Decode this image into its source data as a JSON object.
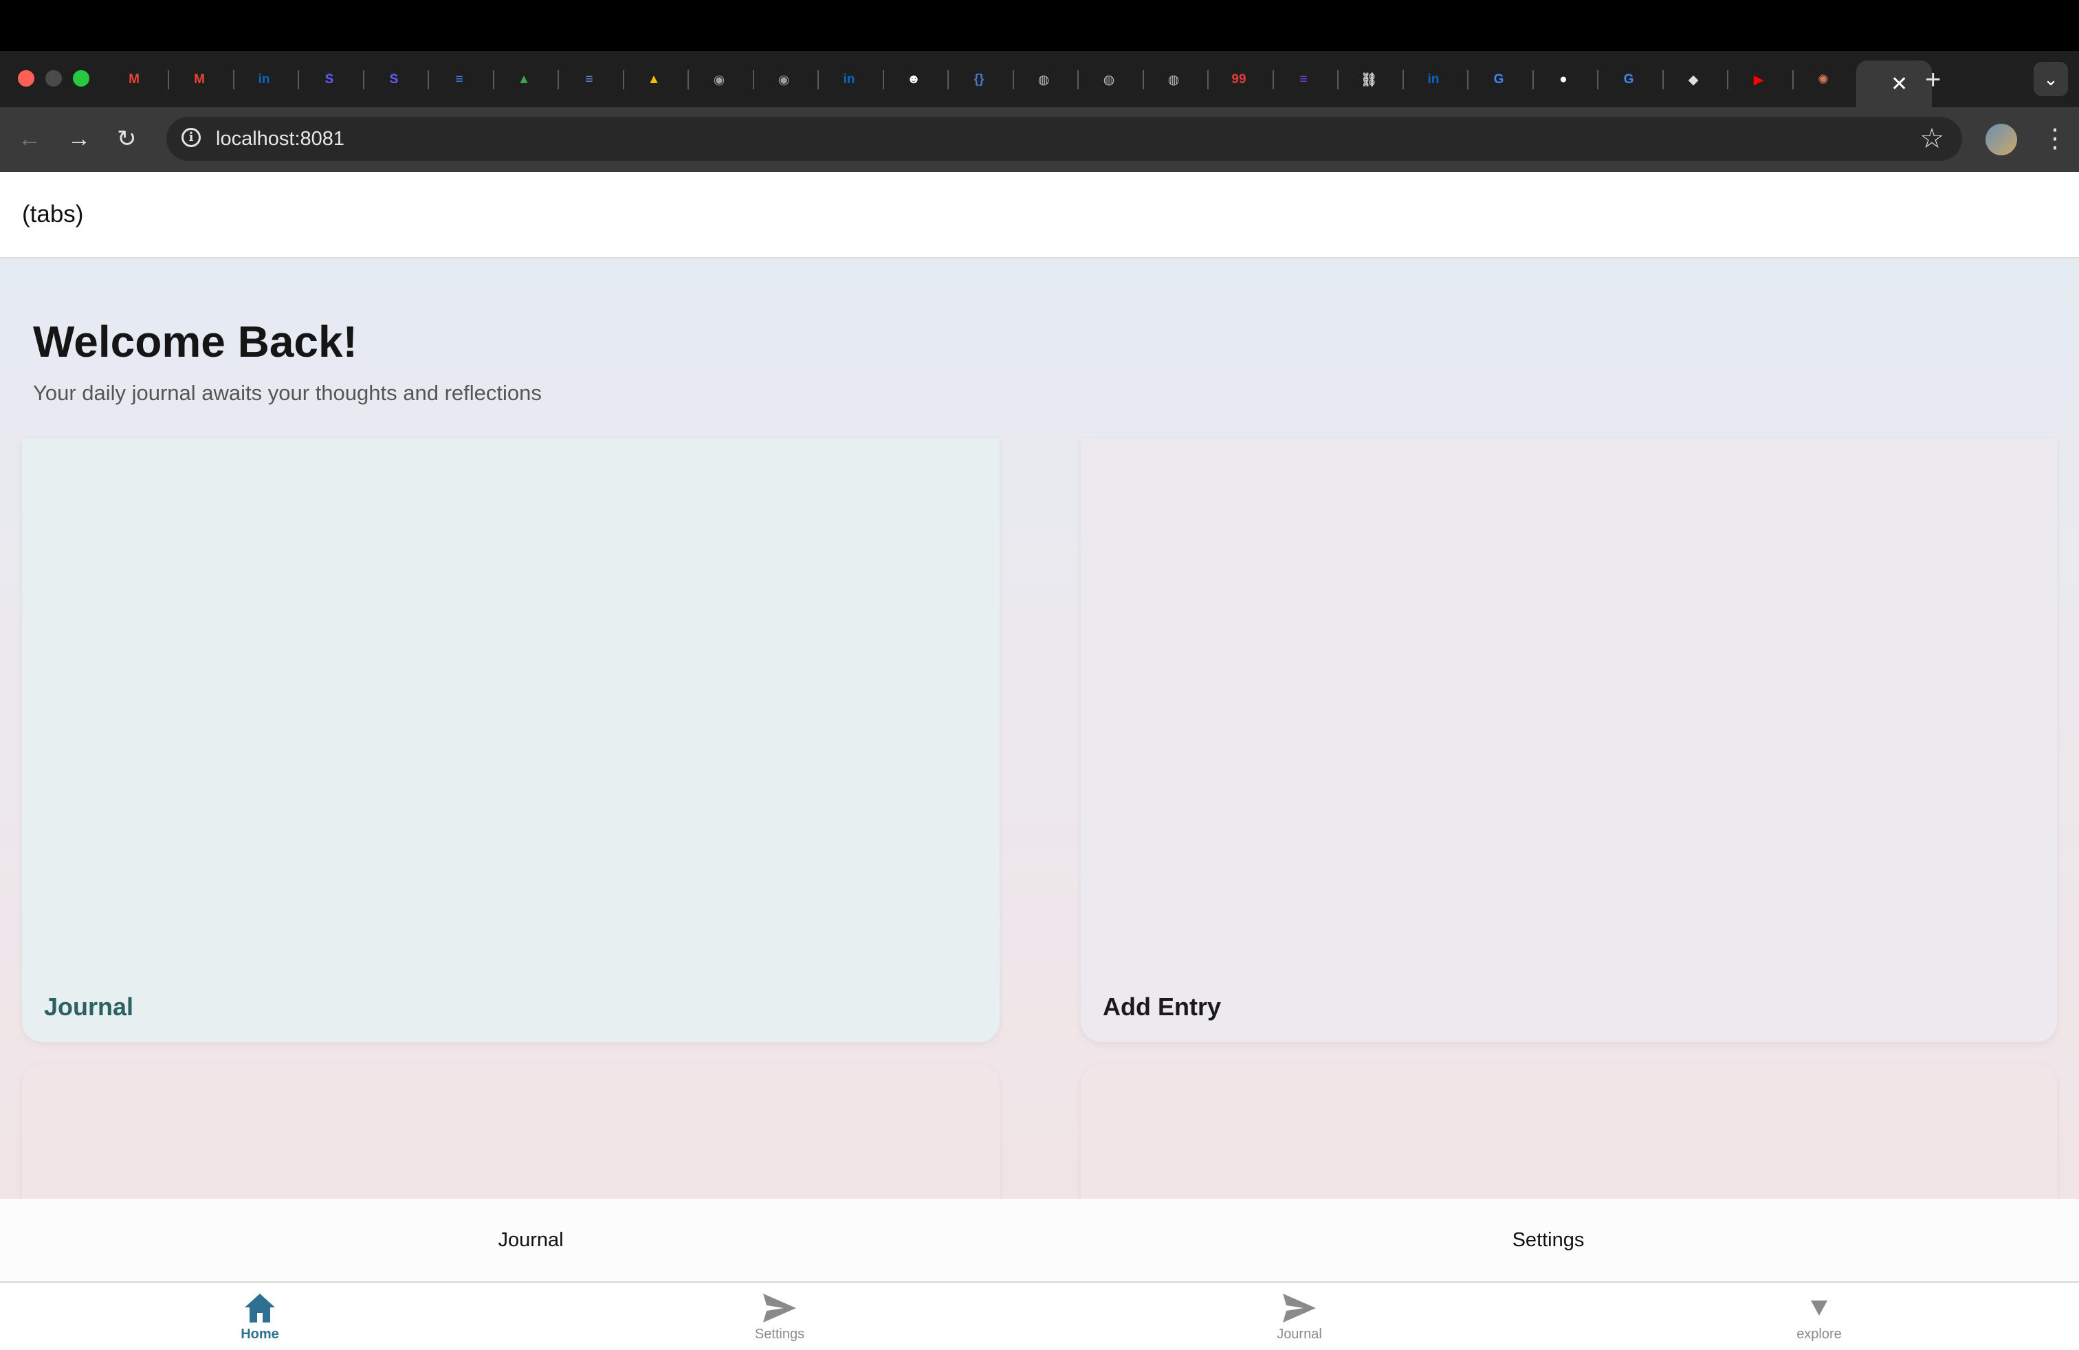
{
  "browser": {
    "url": "localhost:8081",
    "tabs": [
      {
        "icon": "gmail-icon",
        "glyph": "M",
        "color": "#ea4335"
      },
      {
        "icon": "gmail-icon",
        "glyph": "M",
        "color": "#ea4335"
      },
      {
        "icon": "linkedin-icon",
        "glyph": "in",
        "color": "#0a66c2"
      },
      {
        "icon": "stripe-s-icon",
        "glyph": "S",
        "color": "#635bff"
      },
      {
        "icon": "stripe-s-icon",
        "glyph": "S",
        "color": "#635bff"
      },
      {
        "icon": "docs-icon",
        "glyph": "≡",
        "color": "#4285f4"
      },
      {
        "icon": "drive-icon",
        "glyph": "▲",
        "color": "#34a853"
      },
      {
        "icon": "list-icon",
        "glyph": "≡",
        "color": "#6a8ad8"
      },
      {
        "icon": "drive-icon",
        "glyph": "▲",
        "color": "#fbbc04"
      },
      {
        "icon": "chrome-icon",
        "glyph": "◉",
        "color": "#9e9e9e"
      },
      {
        "icon": "chrome-icon",
        "glyph": "◉",
        "color": "#9e9e9e"
      },
      {
        "icon": "linkedin-icon",
        "glyph": "in",
        "color": "#0a66c2"
      },
      {
        "icon": "reddit-icon",
        "glyph": "☻",
        "color": "#ffffff"
      },
      {
        "icon": "code-braces-icon",
        "glyph": "{}",
        "color": "#4a78c8"
      },
      {
        "icon": "globe-icon",
        "glyph": "◍",
        "color": "#bdbdbd"
      },
      {
        "icon": "globe-icon",
        "glyph": "◍",
        "color": "#bdbdbd"
      },
      {
        "icon": "globe-icon",
        "glyph": "◍",
        "color": "#bdbdbd"
      },
      {
        "icon": "badge-99-icon",
        "glyph": "99",
        "color": "#e23b3b"
      },
      {
        "icon": "list-icon",
        "glyph": "≡",
        "color": "#7b3fe4"
      },
      {
        "icon": "link-icon",
        "glyph": "⛓",
        "color": "#cfcfcf"
      },
      {
        "icon": "linkedin-icon",
        "glyph": "in",
        "color": "#0a66c2"
      },
      {
        "icon": "google-icon",
        "glyph": "G",
        "color": "#4285f4"
      },
      {
        "icon": "github-icon",
        "glyph": "●",
        "color": "#ffffff"
      },
      {
        "icon": "google-icon",
        "glyph": "G",
        "color": "#4285f4"
      },
      {
        "icon": "puzzle-icon",
        "glyph": "◆",
        "color": "#e0e0e0"
      },
      {
        "icon": "youtube-icon",
        "glyph": "▶",
        "color": "#ff0000"
      },
      {
        "icon": "claude-icon",
        "glyph": "✺",
        "color": "#d97757"
      }
    ],
    "active_tab_close": "✕",
    "new_tab": "+"
  },
  "app": {
    "header_title": "(tabs)",
    "welcome": "Welcome Back!",
    "subtitle": "Your daily journal awaits your thoughts and reflections",
    "cards": {
      "journal": "Journal",
      "add_entry": "Add Entry"
    },
    "top_tabs": [
      "Journal",
      "Settings"
    ],
    "bottom_nav": [
      {
        "label": "Home",
        "icon": "home-icon",
        "active": true
      },
      {
        "label": "Settings",
        "icon": "send-icon",
        "active": false
      },
      {
        "label": "Journal",
        "icon": "send-icon",
        "active": false
      },
      {
        "label": "explore",
        "icon": "triangle-down-icon",
        "active": false
      }
    ],
    "colors": {
      "accent": "#2f6f91",
      "journal_card_text": "#2b6163"
    }
  }
}
